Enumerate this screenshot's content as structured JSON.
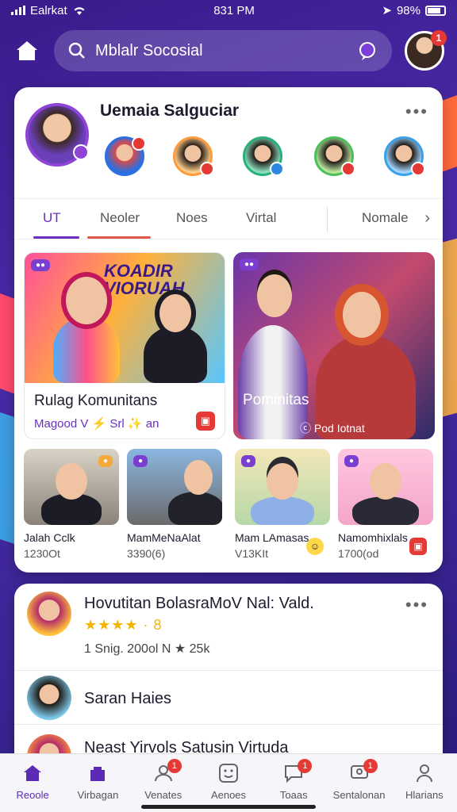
{
  "status_bar": {
    "carrier": "Ealrkat",
    "time": "831 PM",
    "battery": "98%"
  },
  "search": {
    "placeholder": "Mblalr Socosial"
  },
  "top_avatar": {
    "badge": "1"
  },
  "card1": {
    "title": "Uemaia Salguciar",
    "tabs": [
      "UT",
      "Neoler",
      "Noes",
      "Virtal",
      "Nomale"
    ],
    "tiles": [
      {
        "poster": "KOADIR VIORUAH",
        "title": "Rulag Komunitans",
        "subtitle": "Magood V ⚡ Srl ✨ an"
      },
      {
        "title": "Pominitas",
        "subtitle": "ⓒ Pod Iotnat"
      }
    ],
    "small_tiles": [
      {
        "name": "Jalah Cclk",
        "count": "1230Ot"
      },
      {
        "name": "MamMeNaAlat",
        "count": "3390(6)"
      },
      {
        "name": "Mam LAmasas",
        "count": "V13KIt"
      },
      {
        "name": "Namomhixlals",
        "count": "1700(od"
      }
    ]
  },
  "card2": {
    "items": [
      {
        "title": "Hovutitan BolasraMoV Nal: Vald.",
        "rating": "★★★★ · 8",
        "meta": "1 Snig. 200ol N ★ 25k"
      },
      {
        "title": "Saran Haies"
      },
      {
        "title": "Neast Yirvols Satusin Virtuda"
      }
    ]
  },
  "bottom_nav": [
    {
      "label": "Reoole",
      "badge": ""
    },
    {
      "label": "Virbagan",
      "badge": ""
    },
    {
      "label": "Venates",
      "badge": "1"
    },
    {
      "label": "Aenoes",
      "badge": ""
    },
    {
      "label": "Toaas",
      "badge": "1"
    },
    {
      "label": "Sentalonan",
      "badge": "1"
    },
    {
      "label": "Hlarians",
      "badge": ""
    }
  ],
  "colors": {
    "accent": "#6b2fc4",
    "badge": "#e53935",
    "star": "#f5b400"
  }
}
